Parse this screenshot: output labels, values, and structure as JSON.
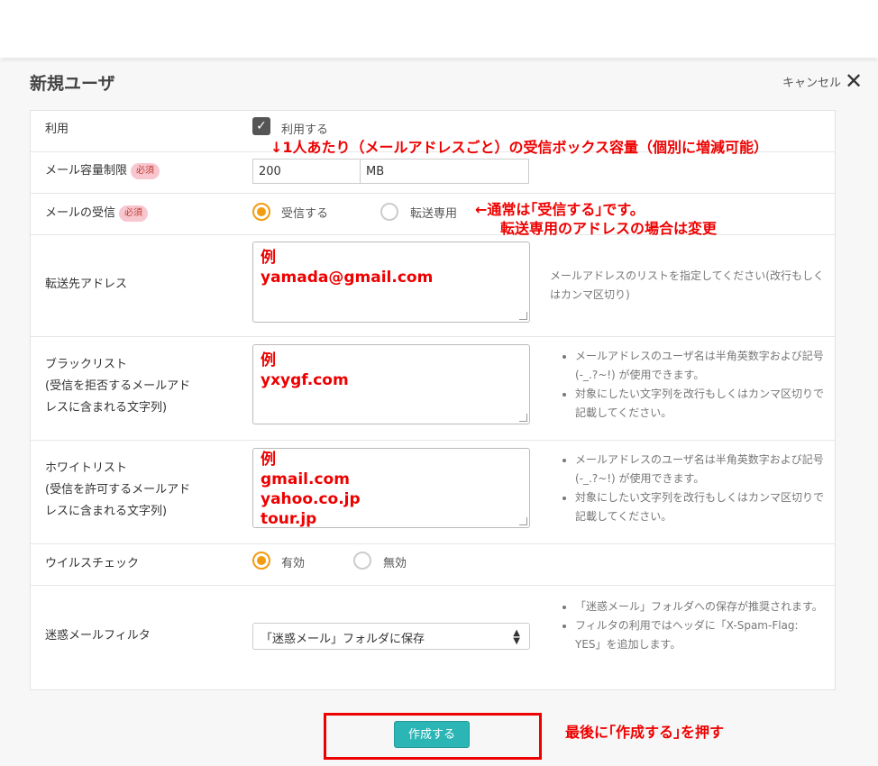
{
  "header": {
    "title": "新規ユーザ",
    "cancel_label": "キャンセル",
    "close_icon": "close-icon"
  },
  "form": {
    "use": {
      "label": "利用",
      "checkbox_label": "利用する",
      "checked": true
    },
    "quota": {
      "label": "メール容量制限",
      "required": "必須",
      "value": "200",
      "unit": "MB"
    },
    "receive": {
      "label": "メールの受信",
      "required": "必須",
      "options": [
        "受信する",
        "転送専用"
      ],
      "selected": "受信する"
    },
    "forward": {
      "label": "転送先アドレス",
      "lines": [
        "例",
        "yamada@gmail.com"
      ],
      "help": "メールアドレスのリストを指定してください(改行もしくはカンマ区切り)"
    },
    "blacklist": {
      "label": [
        "ブラックリスト",
        "(受信を拒否するメールアド",
        "レスに含まれる文字列)"
      ],
      "lines": [
        "例",
        "yxygf.com"
      ],
      "help": [
        "メールアドレスのユーザ名は半角英数字および記号(-_.?~!) が使用できます。",
        "対象にしたい文字列を改行もしくはカンマ区切りで記載してください。"
      ]
    },
    "whitelist": {
      "label": [
        "ホワイトリスト",
        "(受信を許可するメールアド",
        "レスに含まれる文字列)"
      ],
      "lines": [
        "例",
        "gmail.com",
        "yahoo.co.jp",
        "tour.jp"
      ],
      "help": [
        "メールアドレスのユーザ名は半角英数字および記号(-_.?~!) が使用できます。",
        "対象にしたい文字列を改行もしくはカンマ区切りで記載してください。"
      ]
    },
    "virus": {
      "label": "ウイルスチェック",
      "options": [
        "有効",
        "無効"
      ],
      "selected": "有効"
    },
    "spam": {
      "label": "迷惑メールフィルタ",
      "selected": "「迷惑メール」フォルダに保存",
      "help": [
        "「迷惑メール」フォルダへの保存が推奨されます。",
        "フィルタの利用ではヘッダに「X-Spam-Flag: YES」を追加します。"
      ]
    }
  },
  "submit_label": "作成する",
  "annotations": {
    "quota_note": "↓1人あたり（メールアドレスごと）の受信ボックス容量（個別に増減可能）",
    "receive_note_1": "←通常は｢受信する｣です。",
    "receive_note_2": "転送専用のアドレスの場合は変更",
    "submit_note": "最後に｢作成する｣を押す"
  },
  "colors": {
    "accent": "#f39c12",
    "submit": "#2bb5b5",
    "annotation": "#e00000"
  }
}
